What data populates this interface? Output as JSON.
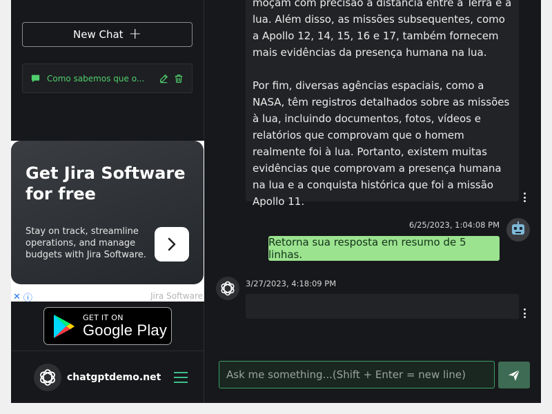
{
  "sidebar": {
    "new_chat_label": "New Chat",
    "new_chat_icon": "+",
    "chats": [
      {
        "title": "Como sabemos que o...",
        "icon": "chat-bubble-icon"
      }
    ],
    "ad": {
      "headline": "Get Jira Software for free",
      "body": "Stay on track, streamline operations, and manage budgets with Jira Software.",
      "brand": "Jira Software",
      "close_glyph": "✕",
      "info_glyph": "ⓘ"
    },
    "google_play": {
      "top": "GET IT ON",
      "bottom": "Google Play"
    },
    "footer": {
      "site_name": "chatgptdemo.net"
    }
  },
  "conversation": {
    "ai_message_1": "moçam com precisão a distância entre a Terra e a lua. Além disso, as missões subsequentes, como a Apollo 12, 14, 15, 16 e 17, também fornecem mais evidências da presença humana na lua.\n\nPor fim, diversas agências espaciais, como a NASA, têm registros detalhados sobre as missões à lua, incluindo documentos, fotos, vídeos e relatórios que comprovam que o homem realmente foi à lua. Portanto, existem muitas evidências que comprovam a presença humana na lua e a conquista histórica que foi a missão Apollo 11.",
    "user_message": {
      "timestamp": "6/25/2023, 1:04:08 PM",
      "text": "Retorna sua resposta em resumo de 5 linhas."
    },
    "ai_message_2": {
      "timestamp": "3/27/2023, 4:18:09 PM",
      "text": ""
    }
  },
  "input": {
    "placeholder": "Ask me something...(Shift + Enter = new line)",
    "value": ""
  },
  "colors": {
    "accent_green": "#4fd06d",
    "user_bubble": "#9be38f",
    "send_button": "#3e6b53",
    "background": "#17181b"
  }
}
